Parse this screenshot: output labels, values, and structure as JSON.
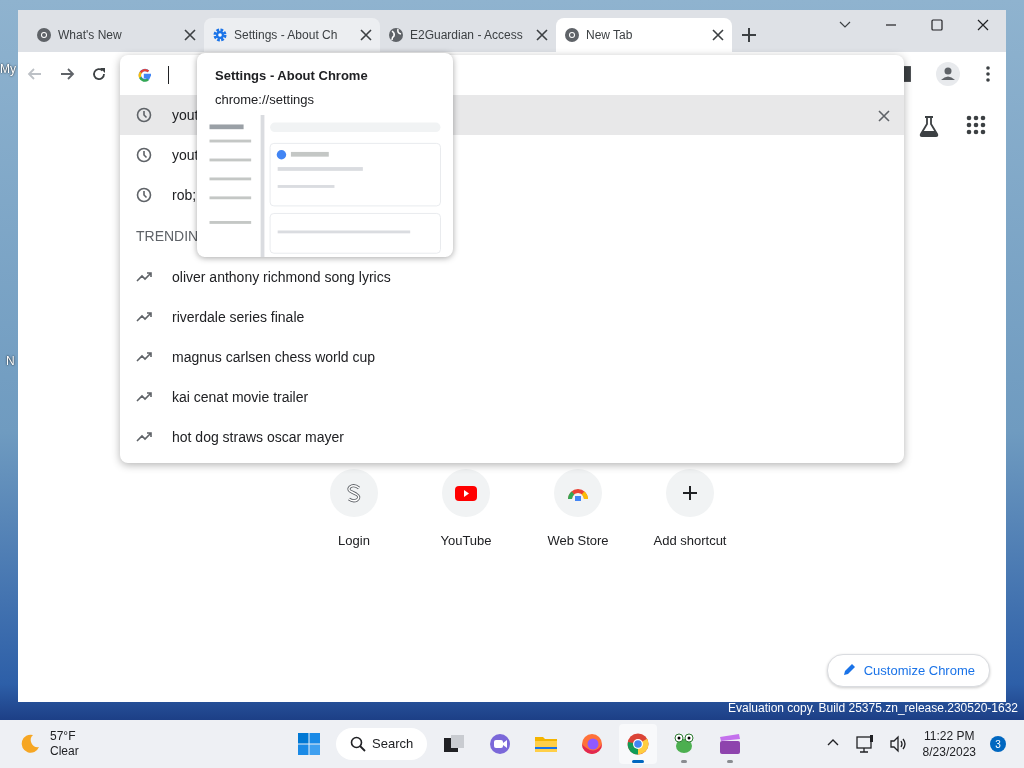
{
  "desktop": {
    "icon_labels": [
      "My",
      "N"
    ],
    "notice_lines": [
      "Evaluation copy. Build 25375.zn_release.230520-1632"
    ]
  },
  "tabs": [
    {
      "title": "What's New",
      "selected": false,
      "hovered": false
    },
    {
      "title": "Settings - About Ch",
      "selected": false,
      "hovered": true
    },
    {
      "title": "E2Guardian - Access",
      "selected": false,
      "hovered": false
    },
    {
      "title": "New Tab",
      "selected": true,
      "hovered": false
    }
  ],
  "suggestions": [
    {
      "kind": "history",
      "text": "yout",
      "selected": true
    },
    {
      "kind": "history",
      "text": "yout",
      "selected": false
    },
    {
      "kind": "history",
      "text": "rob;",
      "selected": false
    },
    {
      "kind": "header",
      "text": "TRENDIN"
    },
    {
      "kind": "trending",
      "text": "oliver anthony richmond song lyrics",
      "selected": false
    },
    {
      "kind": "trending",
      "text": "riverdale series finale",
      "selected": false
    },
    {
      "kind": "trending",
      "text": "magnus carlsen chess world cup",
      "selected": false
    },
    {
      "kind": "trending",
      "text": "kai cenat movie trailer",
      "selected": false
    },
    {
      "kind": "trending",
      "text": "hot dog straws oscar mayer",
      "selected": false
    }
  ],
  "hover_card": {
    "title": "Settings - About Chrome",
    "url": "chrome://settings"
  },
  "shortcuts": [
    {
      "label": "Login",
      "kind": "s-logo"
    },
    {
      "label": "YouTube",
      "kind": "youtube"
    },
    {
      "label": "Web Store",
      "kind": "webstore"
    },
    {
      "label": "Add shortcut",
      "kind": "add"
    }
  ],
  "customize_button": "Customize Chrome",
  "taskbar": {
    "weather": {
      "temperature": "57°F",
      "condition": "Clear"
    },
    "search_label": "Search",
    "apps": [
      {
        "kind": "taskview",
        "active": false
      },
      {
        "kind": "chat",
        "active": false
      },
      {
        "kind": "folder",
        "active": false
      },
      {
        "kind": "firefox",
        "active": false
      },
      {
        "kind": "chrome",
        "active": true
      },
      {
        "kind": "frog",
        "active": false
      },
      {
        "kind": "clapper",
        "active": false
      }
    ],
    "time": "11:22 PM",
    "date": "8/23/2023",
    "notification_count": "3"
  }
}
